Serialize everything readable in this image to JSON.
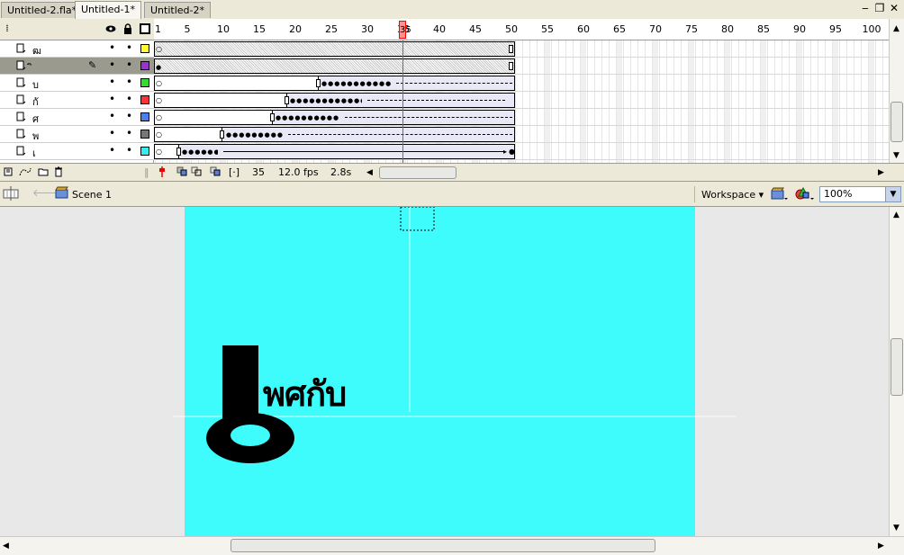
{
  "tabs": [
    {
      "label": "Untitled-2.fla*",
      "active": false
    },
    {
      "label": "Untitled-1*",
      "active": true
    },
    {
      "label": "Untitled-2*",
      "active": false
    }
  ],
  "window_controls": {
    "minimize": "‒",
    "restore": "❐",
    "close": "✕"
  },
  "timeline": {
    "ruler": [
      1,
      5,
      10,
      15,
      20,
      25,
      30,
      35,
      40,
      45,
      50,
      55,
      60,
      65,
      70,
      75,
      80,
      85,
      90,
      95,
      100
    ],
    "current_frame_marker": "35",
    "layers": [
      {
        "name": "ฒ",
        "color": "#ffff33",
        "selected": false
      },
      {
        "name": "ิ",
        "color": "#9933cc",
        "selected": true
      },
      {
        "name": "บ",
        "color": "#33dd33",
        "selected": false
      },
      {
        "name": "กั",
        "color": "#ff3333",
        "selected": false
      },
      {
        "name": "ศ",
        "color": "#4a80e8",
        "selected": false
      },
      {
        "name": "พ",
        "color": "#777777",
        "selected": false
      },
      {
        "name": "เ",
        "color": "#33eeee",
        "selected": false
      }
    ],
    "status": {
      "current_frame": "35",
      "frame_rate": "12.0 fps",
      "elapsed": "2.8s"
    }
  },
  "editbar": {
    "scene_label": "Scene 1",
    "workspace_label": "Workspace ▾",
    "zoom_value": "100%"
  },
  "stage": {
    "background": "#3ffcfc",
    "artwork_text": "พศกับ"
  }
}
